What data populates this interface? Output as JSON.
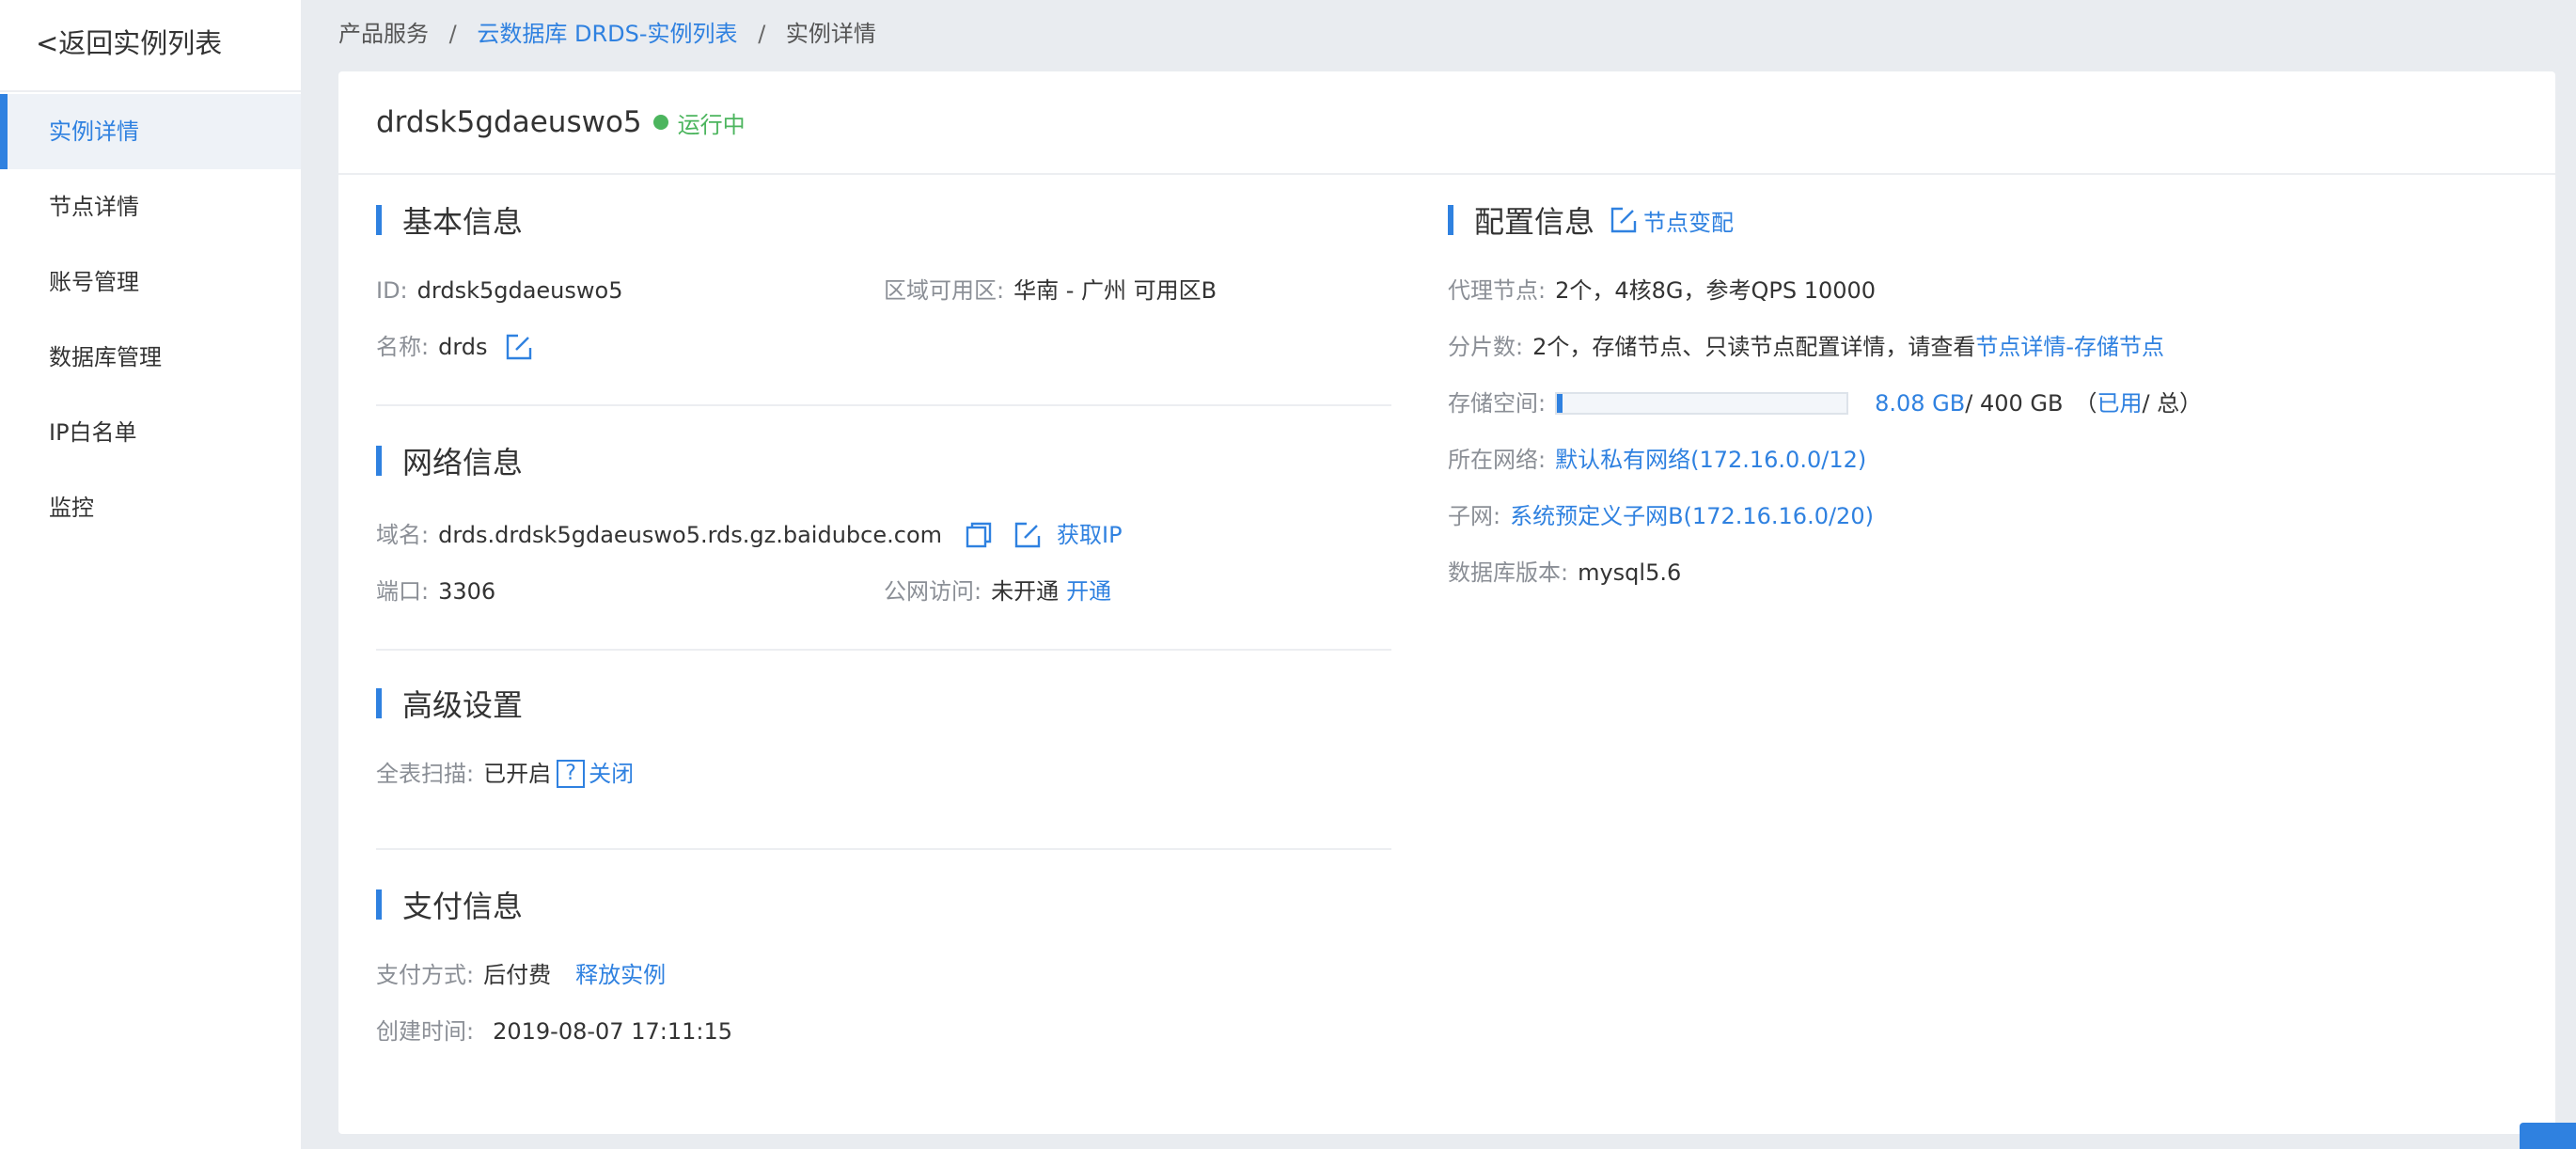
{
  "sidebar": {
    "back_label": "<返回实例列表",
    "items": [
      {
        "label": "实例详情",
        "active": true
      },
      {
        "label": "节点详情"
      },
      {
        "label": "账号管理"
      },
      {
        "label": "数据库管理"
      },
      {
        "label": "IP白名单"
      },
      {
        "label": "监控"
      }
    ]
  },
  "breadcrumb": {
    "items": [
      "产品服务",
      "云数据库 DRDS-实例列表",
      "实例详情"
    ],
    "separator": "/"
  },
  "header": {
    "instance_name": "drdsk5gdaeuswo5",
    "status": "运行中",
    "status_color": "#4cb55e"
  },
  "basic": {
    "title": "基本信息",
    "id_label": "ID:",
    "id_value": "drdsk5gdaeuswo5",
    "zone_label": "区域可用区:",
    "zone_value": "华南 - 广州 可用区B",
    "name_label": "名称:",
    "name_value": "drds",
    "edit_icon": "edit-icon"
  },
  "network": {
    "title": "网络信息",
    "domain_label": "域名:",
    "domain_value": "drds.drdsk5gdaeuswo5.rds.gz.baidubce.com",
    "copy_icon": "copy-icon",
    "get_ip_label": "获取IP",
    "port_label": "端口:",
    "port_value": "3306",
    "public_label": "公网访问:",
    "public_value": "未开通",
    "open_label": "开通"
  },
  "advanced": {
    "title": "高级设置",
    "scan_label": "全表扫描:",
    "scan_value": "已开启",
    "help_icon": "?",
    "close_label": "关闭"
  },
  "payment": {
    "title": "支付信息",
    "method_label": "支付方式:",
    "method_value": "后付费",
    "release_label": "释放实例",
    "created_label": "创建时间:",
    "created_value": "2019-08-07 17:11:15"
  },
  "config": {
    "title": "配置信息",
    "change_label": "节点变配",
    "proxy_label": "代理节点:",
    "proxy_value": "2个，4核8G，参考QPS 10000",
    "shard_label": "分片数:",
    "shard_value": "2个，存储节点、只读节点配置详情，请查看",
    "shard_link": "节点详情-存储节点",
    "storage_label": "存储空间:",
    "storage_used": "8.08 GB",
    "storage_total": " / 400 GB",
    "storage_legend_open": "（",
    "storage_legend_used": "已用",
    "storage_legend_rest": " / 总）",
    "storage_fraction": 0.0202,
    "network_label": "所在网络:",
    "network_value": "默认私有网络(172.16.0.0/12)",
    "subnet_label": "子网:",
    "subnet_value": "系统预定义子网B(172.16.16.0/20)",
    "dbver_label": "数据库版本:",
    "dbver_value": "mysql5.6"
  },
  "colors": {
    "accent": "#2f81e0",
    "success": "#4cb55e",
    "background": "#e9ecf0"
  }
}
